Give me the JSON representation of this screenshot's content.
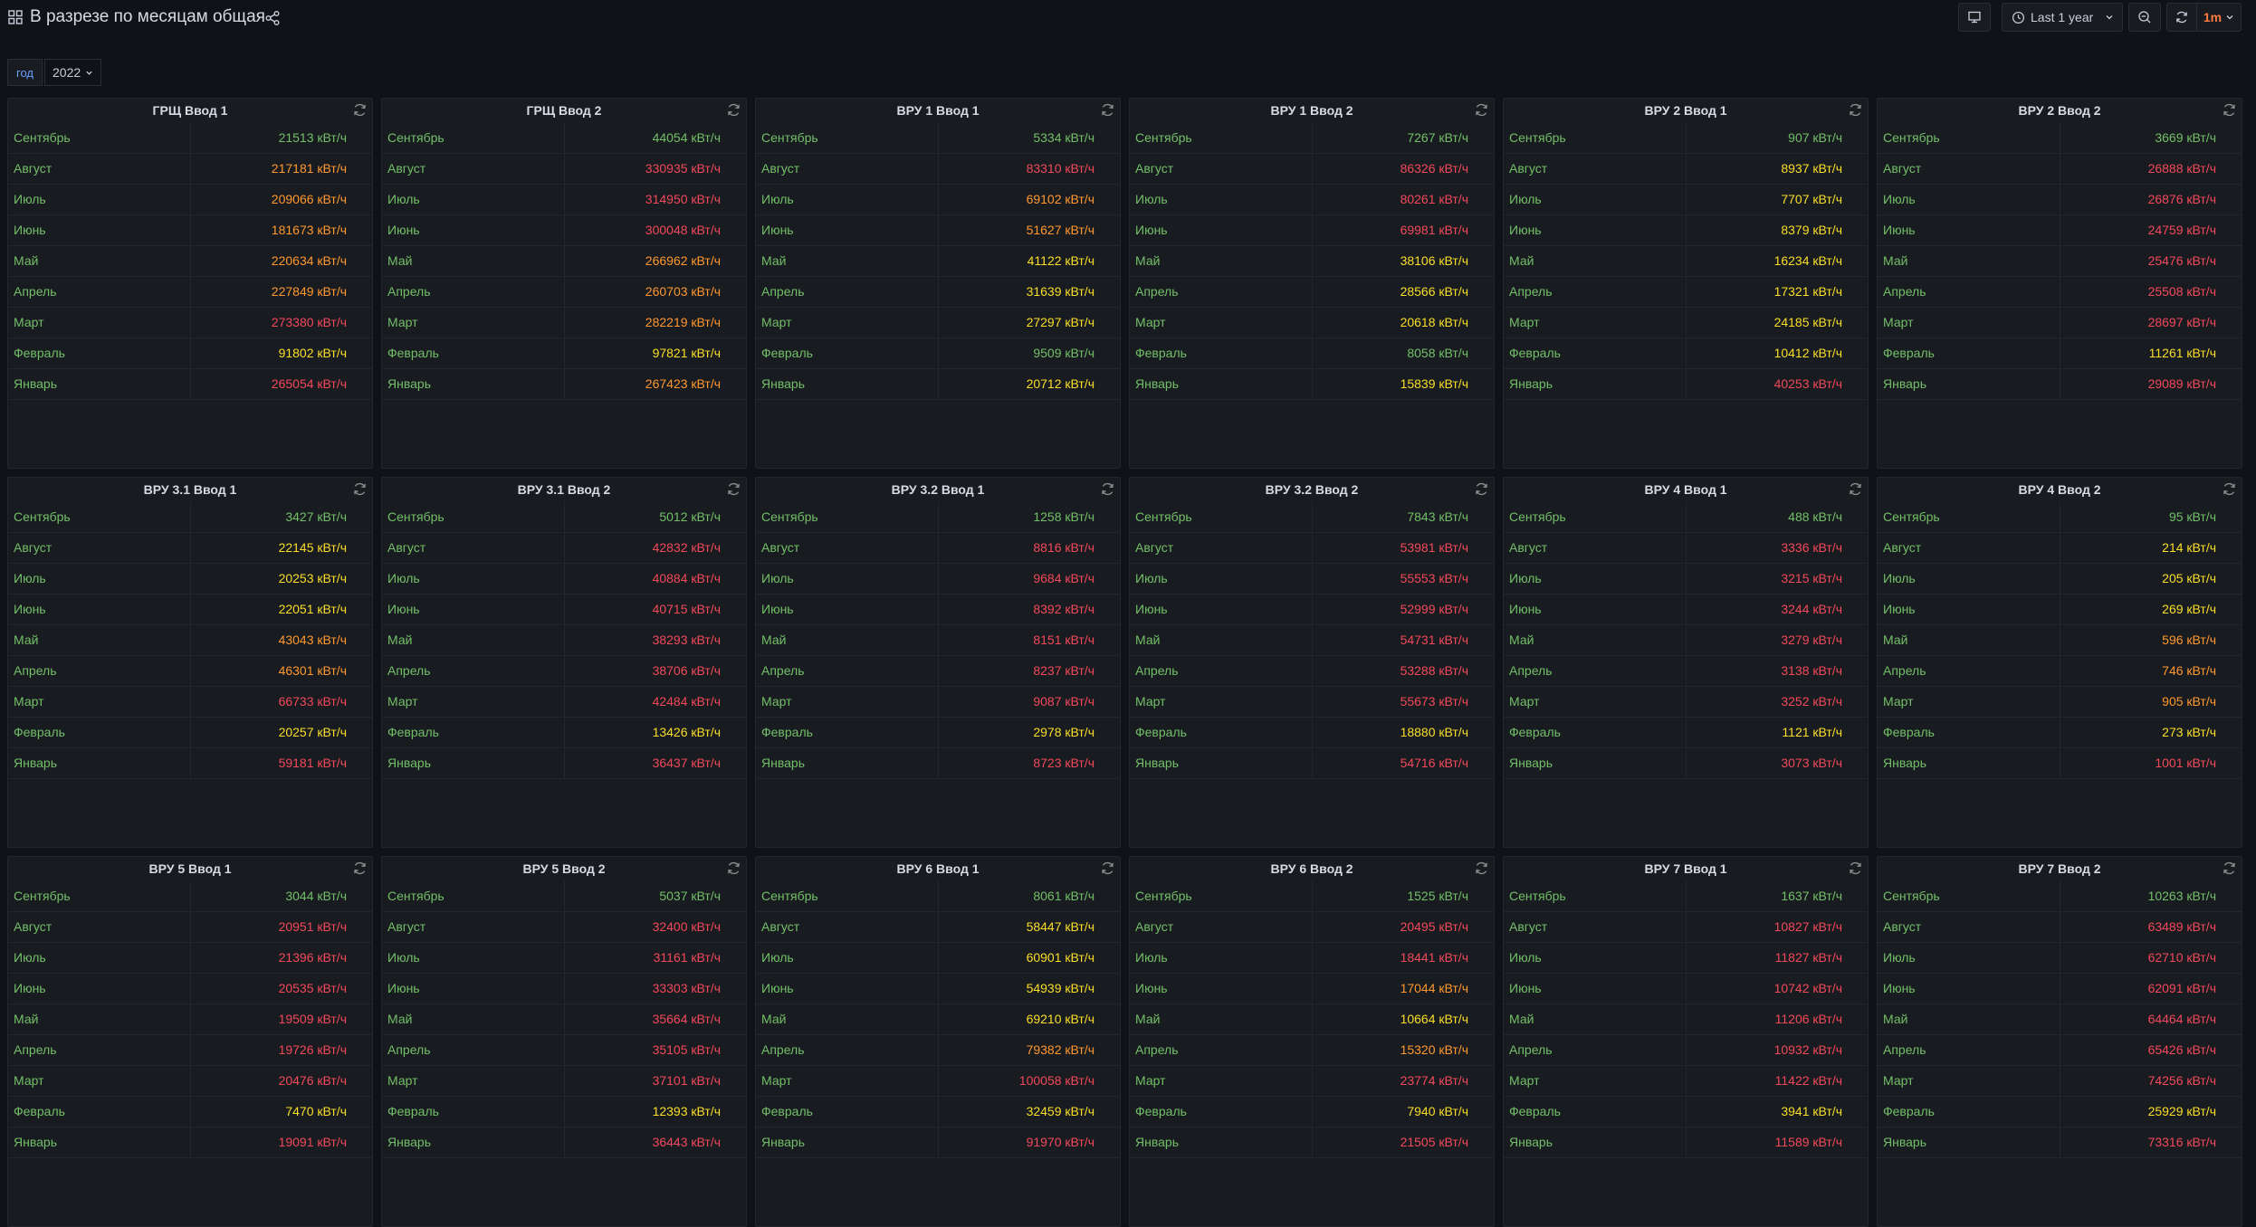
{
  "dashboard": {
    "title": "В разрезе по месяцам общая"
  },
  "toolbar": {
    "time_range": "Last 1 year",
    "refresh_interval": "1m"
  },
  "variables": {
    "year_label": "год",
    "year_value": "2022"
  },
  "colors": {
    "green": "#73bf69",
    "yellow": "#fade2a",
    "orange": "#ff9830",
    "red": "#f2495c"
  },
  "unit": "кВт/ч",
  "panels": [
    {
      "title": "ГРЩ Ввод 1",
      "rows": [
        {
          "month": "Сентябрь",
          "value": "21513 кВт/ч",
          "color": "green"
        },
        {
          "month": "Август",
          "value": "217181 кВт/ч",
          "color": "orange"
        },
        {
          "month": "Июль",
          "value": "209066 кВт/ч",
          "color": "orange"
        },
        {
          "month": "Июнь",
          "value": "181673 кВт/ч",
          "color": "orange"
        },
        {
          "month": "Май",
          "value": "220634 кВт/ч",
          "color": "orange"
        },
        {
          "month": "Апрель",
          "value": "227849 кВт/ч",
          "color": "orange"
        },
        {
          "month": "Март",
          "value": "273380 кВт/ч",
          "color": "red"
        },
        {
          "month": "Февраль",
          "value": "91802 кВт/ч",
          "color": "yellow"
        },
        {
          "month": "Январь",
          "value": "265054 кВт/ч",
          "color": "red"
        }
      ]
    },
    {
      "title": "ГРЩ Ввод 2",
      "rows": [
        {
          "month": "Сентябрь",
          "value": "44054 кВт/ч",
          "color": "green"
        },
        {
          "month": "Август",
          "value": "330935 кВт/ч",
          "color": "red"
        },
        {
          "month": "Июль",
          "value": "314950 кВт/ч",
          "color": "red"
        },
        {
          "month": "Июнь",
          "value": "300048 кВт/ч",
          "color": "red"
        },
        {
          "month": "Май",
          "value": "266962 кВт/ч",
          "color": "orange"
        },
        {
          "month": "Апрель",
          "value": "260703 кВт/ч",
          "color": "orange"
        },
        {
          "month": "Март",
          "value": "282219 кВт/ч",
          "color": "orange"
        },
        {
          "month": "Февраль",
          "value": "97821 кВт/ч",
          "color": "yellow"
        },
        {
          "month": "Январь",
          "value": "267423 кВт/ч",
          "color": "orange"
        }
      ]
    },
    {
      "title": "ВРУ 1 Ввод 1",
      "rows": [
        {
          "month": "Сентябрь",
          "value": "5334 кВт/ч",
          "color": "green"
        },
        {
          "month": "Август",
          "value": "83310 кВт/ч",
          "color": "red"
        },
        {
          "month": "Июль",
          "value": "69102 кВт/ч",
          "color": "orange"
        },
        {
          "month": "Июнь",
          "value": "51627 кВт/ч",
          "color": "orange"
        },
        {
          "month": "Май",
          "value": "41122 кВт/ч",
          "color": "yellow"
        },
        {
          "month": "Апрель",
          "value": "31639 кВт/ч",
          "color": "yellow"
        },
        {
          "month": "Март",
          "value": "27297 кВт/ч",
          "color": "yellow"
        },
        {
          "month": "Февраль",
          "value": "9509 кВт/ч",
          "color": "green"
        },
        {
          "month": "Январь",
          "value": "20712 кВт/ч",
          "color": "yellow"
        }
      ]
    },
    {
      "title": "ВРУ 1 Ввод 2",
      "rows": [
        {
          "month": "Сентябрь",
          "value": "7267 кВт/ч",
          "color": "green"
        },
        {
          "month": "Август",
          "value": "86326 кВт/ч",
          "color": "red"
        },
        {
          "month": "Июль",
          "value": "80261 кВт/ч",
          "color": "red"
        },
        {
          "month": "Июнь",
          "value": "69981 кВт/ч",
          "color": "red"
        },
        {
          "month": "Май",
          "value": "38106 кВт/ч",
          "color": "yellow"
        },
        {
          "month": "Апрель",
          "value": "28566 кВт/ч",
          "color": "yellow"
        },
        {
          "month": "Март",
          "value": "20618 кВт/ч",
          "color": "yellow"
        },
        {
          "month": "Февраль",
          "value": "8058 кВт/ч",
          "color": "green"
        },
        {
          "month": "Январь",
          "value": "15839 кВт/ч",
          "color": "yellow"
        }
      ]
    },
    {
      "title": "ВРУ 2 Ввод 1",
      "rows": [
        {
          "month": "Сентябрь",
          "value": "907 кВт/ч",
          "color": "green"
        },
        {
          "month": "Август",
          "value": "8937 кВт/ч",
          "color": "yellow"
        },
        {
          "month": "Июль",
          "value": "7707 кВт/ч",
          "color": "yellow"
        },
        {
          "month": "Июнь",
          "value": "8379 кВт/ч",
          "color": "yellow"
        },
        {
          "month": "Май",
          "value": "16234 кВт/ч",
          "color": "yellow"
        },
        {
          "month": "Апрель",
          "value": "17321 кВт/ч",
          "color": "yellow"
        },
        {
          "month": "Март",
          "value": "24185 кВт/ч",
          "color": "yellow"
        },
        {
          "month": "Февраль",
          "value": "10412 кВт/ч",
          "color": "yellow"
        },
        {
          "month": "Январь",
          "value": "40253 кВт/ч",
          "color": "red"
        }
      ]
    },
    {
      "title": "ВРУ 2 Ввод 2",
      "rows": [
        {
          "month": "Сентябрь",
          "value": "3669 кВт/ч",
          "color": "green"
        },
        {
          "month": "Август",
          "value": "26888 кВт/ч",
          "color": "red"
        },
        {
          "month": "Июль",
          "value": "26876 кВт/ч",
          "color": "red"
        },
        {
          "month": "Июнь",
          "value": "24759 кВт/ч",
          "color": "red"
        },
        {
          "month": "Май",
          "value": "25476 кВт/ч",
          "color": "red"
        },
        {
          "month": "Апрель",
          "value": "25508 кВт/ч",
          "color": "red"
        },
        {
          "month": "Март",
          "value": "28697 кВт/ч",
          "color": "red"
        },
        {
          "month": "Февраль",
          "value": "11261 кВт/ч",
          "color": "yellow"
        },
        {
          "month": "Январь",
          "value": "29089 кВт/ч",
          "color": "red"
        }
      ]
    },
    {
      "title": "ВРУ 3.1 Ввод 1",
      "rows": [
        {
          "month": "Сентябрь",
          "value": "3427 кВт/ч",
          "color": "green"
        },
        {
          "month": "Август",
          "value": "22145 кВт/ч",
          "color": "yellow"
        },
        {
          "month": "Июль",
          "value": "20253 кВт/ч",
          "color": "yellow"
        },
        {
          "month": "Июнь",
          "value": "22051 кВт/ч",
          "color": "yellow"
        },
        {
          "month": "Май",
          "value": "43043 кВт/ч",
          "color": "orange"
        },
        {
          "month": "Апрель",
          "value": "46301 кВт/ч",
          "color": "orange"
        },
        {
          "month": "Март",
          "value": "66733 кВт/ч",
          "color": "red"
        },
        {
          "month": "Февраль",
          "value": "20257 кВт/ч",
          "color": "yellow"
        },
        {
          "month": "Январь",
          "value": "59181 кВт/ч",
          "color": "red"
        }
      ]
    },
    {
      "title": "ВРУ 3.1 Ввод 2",
      "rows": [
        {
          "month": "Сентябрь",
          "value": "5012 кВт/ч",
          "color": "green"
        },
        {
          "month": "Август",
          "value": "42832 кВт/ч",
          "color": "red"
        },
        {
          "month": "Июль",
          "value": "40884 кВт/ч",
          "color": "red"
        },
        {
          "month": "Июнь",
          "value": "40715 кВт/ч",
          "color": "red"
        },
        {
          "month": "Май",
          "value": "38293 кВт/ч",
          "color": "red"
        },
        {
          "month": "Апрель",
          "value": "38706 кВт/ч",
          "color": "red"
        },
        {
          "month": "Март",
          "value": "42484 кВт/ч",
          "color": "red"
        },
        {
          "month": "Февраль",
          "value": "13426 кВт/ч",
          "color": "yellow"
        },
        {
          "month": "Январь",
          "value": "36437 кВт/ч",
          "color": "red"
        }
      ]
    },
    {
      "title": "ВРУ 3.2 Ввод 1",
      "rows": [
        {
          "month": "Сентябрь",
          "value": "1258 кВт/ч",
          "color": "green"
        },
        {
          "month": "Август",
          "value": "8816 кВт/ч",
          "color": "red"
        },
        {
          "month": "Июль",
          "value": "9684 кВт/ч",
          "color": "red"
        },
        {
          "month": "Июнь",
          "value": "8392 кВт/ч",
          "color": "red"
        },
        {
          "month": "Май",
          "value": "8151 кВт/ч",
          "color": "red"
        },
        {
          "month": "Апрель",
          "value": "8237 кВт/ч",
          "color": "red"
        },
        {
          "month": "Март",
          "value": "9087 кВт/ч",
          "color": "red"
        },
        {
          "month": "Февраль",
          "value": "2978 кВт/ч",
          "color": "yellow"
        },
        {
          "month": "Январь",
          "value": "8723 кВт/ч",
          "color": "red"
        }
      ]
    },
    {
      "title": "ВРУ 3.2 Ввод 2",
      "rows": [
        {
          "month": "Сентябрь",
          "value": "7843 кВт/ч",
          "color": "green"
        },
        {
          "month": "Август",
          "value": "53981 кВт/ч",
          "color": "red"
        },
        {
          "month": "Июль",
          "value": "55553 кВт/ч",
          "color": "red"
        },
        {
          "month": "Июнь",
          "value": "52999 кВт/ч",
          "color": "red"
        },
        {
          "month": "Май",
          "value": "54731 кВт/ч",
          "color": "red"
        },
        {
          "month": "Апрель",
          "value": "53288 кВт/ч",
          "color": "red"
        },
        {
          "month": "Март",
          "value": "55673 кВт/ч",
          "color": "red"
        },
        {
          "month": "Февраль",
          "value": "18880 кВт/ч",
          "color": "yellow"
        },
        {
          "month": "Январь",
          "value": "54716 кВт/ч",
          "color": "red"
        }
      ]
    },
    {
      "title": "ВРУ 4 Ввод 1",
      "rows": [
        {
          "month": "Сентябрь",
          "value": "488 кВт/ч",
          "color": "green"
        },
        {
          "month": "Август",
          "value": "3336 кВт/ч",
          "color": "red"
        },
        {
          "month": "Июль",
          "value": "3215 кВт/ч",
          "color": "red"
        },
        {
          "month": "Июнь",
          "value": "3244 кВт/ч",
          "color": "red"
        },
        {
          "month": "Май",
          "value": "3279 кВт/ч",
          "color": "red"
        },
        {
          "month": "Апрель",
          "value": "3138 кВт/ч",
          "color": "red"
        },
        {
          "month": "Март",
          "value": "3252 кВт/ч",
          "color": "red"
        },
        {
          "month": "Февраль",
          "value": "1121 кВт/ч",
          "color": "yellow"
        },
        {
          "month": "Январь",
          "value": "3073 кВт/ч",
          "color": "red"
        }
      ]
    },
    {
      "title": "ВРУ 4 Ввод 2",
      "rows": [
        {
          "month": "Сентябрь",
          "value": "95 кВт/ч",
          "color": "green"
        },
        {
          "month": "Август",
          "value": "214 кВт/ч",
          "color": "yellow"
        },
        {
          "month": "Июль",
          "value": "205 кВт/ч",
          "color": "yellow"
        },
        {
          "month": "Июнь",
          "value": "269 кВт/ч",
          "color": "yellow"
        },
        {
          "month": "Май",
          "value": "596 кВт/ч",
          "color": "orange"
        },
        {
          "month": "Апрель",
          "value": "746 кВт/ч",
          "color": "orange"
        },
        {
          "month": "Март",
          "value": "905 кВт/ч",
          "color": "orange"
        },
        {
          "month": "Февраль",
          "value": "273 кВт/ч",
          "color": "yellow"
        },
        {
          "month": "Январь",
          "value": "1001 кВт/ч",
          "color": "red"
        }
      ]
    },
    {
      "title": "ВРУ 5 Ввод 1",
      "rows": [
        {
          "month": "Сентябрь",
          "value": "3044 кВт/ч",
          "color": "green"
        },
        {
          "month": "Август",
          "value": "20951 кВт/ч",
          "color": "red"
        },
        {
          "month": "Июль",
          "value": "21396 кВт/ч",
          "color": "red"
        },
        {
          "month": "Июнь",
          "value": "20535 кВт/ч",
          "color": "red"
        },
        {
          "month": "Май",
          "value": "19509 кВт/ч",
          "color": "red"
        },
        {
          "month": "Апрель",
          "value": "19726 кВт/ч",
          "color": "red"
        },
        {
          "month": "Март",
          "value": "20476 кВт/ч",
          "color": "red"
        },
        {
          "month": "Февраль",
          "value": "7470 кВт/ч",
          "color": "yellow"
        },
        {
          "month": "Январь",
          "value": "19091 кВт/ч",
          "color": "red"
        }
      ]
    },
    {
      "title": "ВРУ 5 Ввод 2",
      "rows": [
        {
          "month": "Сентябрь",
          "value": "5037 кВт/ч",
          "color": "green"
        },
        {
          "month": "Август",
          "value": "32400 кВт/ч",
          "color": "red"
        },
        {
          "month": "Июль",
          "value": "31161 кВт/ч",
          "color": "red"
        },
        {
          "month": "Июнь",
          "value": "33303 кВт/ч",
          "color": "red"
        },
        {
          "month": "Май",
          "value": "35664 кВт/ч",
          "color": "red"
        },
        {
          "month": "Апрель",
          "value": "35105 кВт/ч",
          "color": "red"
        },
        {
          "month": "Март",
          "value": "37101 кВт/ч",
          "color": "red"
        },
        {
          "month": "Февраль",
          "value": "12393 кВт/ч",
          "color": "yellow"
        },
        {
          "month": "Январь",
          "value": "36443 кВт/ч",
          "color": "red"
        }
      ]
    },
    {
      "title": "ВРУ 6 Ввод 1",
      "rows": [
        {
          "month": "Сентябрь",
          "value": "8061 кВт/ч",
          "color": "green"
        },
        {
          "month": "Август",
          "value": "58447 кВт/ч",
          "color": "yellow"
        },
        {
          "month": "Июль",
          "value": "60901 кВт/ч",
          "color": "yellow"
        },
        {
          "month": "Июнь",
          "value": "54939 кВт/ч",
          "color": "yellow"
        },
        {
          "month": "Май",
          "value": "69210 кВт/ч",
          "color": "yellow"
        },
        {
          "month": "Апрель",
          "value": "79382 кВт/ч",
          "color": "orange"
        },
        {
          "month": "Март",
          "value": "100058 кВт/ч",
          "color": "red"
        },
        {
          "month": "Февраль",
          "value": "32459 кВт/ч",
          "color": "yellow"
        },
        {
          "month": "Январь",
          "value": "91970 кВт/ч",
          "color": "red"
        }
      ]
    },
    {
      "title": "ВРУ 6 Ввод 2",
      "rows": [
        {
          "month": "Сентябрь",
          "value": "1525 кВт/ч",
          "color": "green"
        },
        {
          "month": "Август",
          "value": "20495 кВт/ч",
          "color": "red"
        },
        {
          "month": "Июль",
          "value": "18441 кВт/ч",
          "color": "red"
        },
        {
          "month": "Июнь",
          "value": "17044 кВт/ч",
          "color": "orange"
        },
        {
          "month": "Май",
          "value": "10664 кВт/ч",
          "color": "yellow"
        },
        {
          "month": "Апрель",
          "value": "15320 кВт/ч",
          "color": "orange"
        },
        {
          "month": "Март",
          "value": "23774 кВт/ч",
          "color": "red"
        },
        {
          "month": "Февраль",
          "value": "7940 кВт/ч",
          "color": "yellow"
        },
        {
          "month": "Январь",
          "value": "21505 кВт/ч",
          "color": "red"
        }
      ]
    },
    {
      "title": "ВРУ 7 Ввод 1",
      "rows": [
        {
          "month": "Сентябрь",
          "value": "1637 кВт/ч",
          "color": "green"
        },
        {
          "month": "Август",
          "value": "10827 кВт/ч",
          "color": "red"
        },
        {
          "month": "Июль",
          "value": "11827 кВт/ч",
          "color": "red"
        },
        {
          "month": "Июнь",
          "value": "10742 кВт/ч",
          "color": "red"
        },
        {
          "month": "Май",
          "value": "11206 кВт/ч",
          "color": "red"
        },
        {
          "month": "Апрель",
          "value": "10932 кВт/ч",
          "color": "red"
        },
        {
          "month": "Март",
          "value": "11422 кВт/ч",
          "color": "red"
        },
        {
          "month": "Февраль",
          "value": "3941 кВт/ч",
          "color": "yellow"
        },
        {
          "month": "Январь",
          "value": "11589 кВт/ч",
          "color": "red"
        }
      ]
    },
    {
      "title": "ВРУ 7 Ввод 2",
      "rows": [
        {
          "month": "Сентябрь",
          "value": "10263 кВт/ч",
          "color": "green"
        },
        {
          "month": "Август",
          "value": "63489 кВт/ч",
          "color": "red"
        },
        {
          "month": "Июль",
          "value": "62710 кВт/ч",
          "color": "red"
        },
        {
          "month": "Июнь",
          "value": "62091 кВт/ч",
          "color": "red"
        },
        {
          "month": "Май",
          "value": "64464 кВт/ч",
          "color": "red"
        },
        {
          "month": "Апрель",
          "value": "65426 кВт/ч",
          "color": "red"
        },
        {
          "month": "Март",
          "value": "74256 кВт/ч",
          "color": "red"
        },
        {
          "month": "Февраль",
          "value": "25929 кВт/ч",
          "color": "yellow"
        },
        {
          "month": "Январь",
          "value": "73316 кВт/ч",
          "color": "red"
        }
      ]
    }
  ]
}
